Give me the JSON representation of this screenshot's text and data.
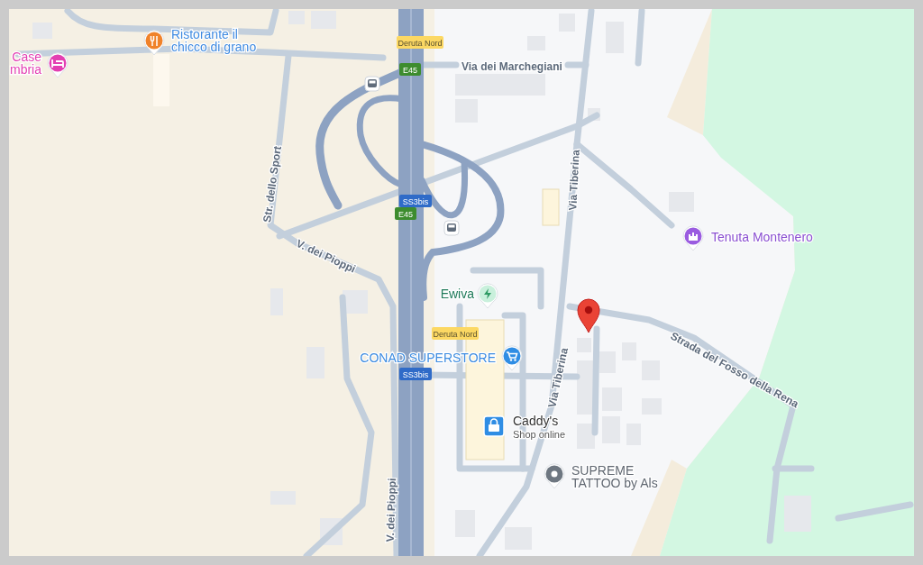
{
  "map": {
    "places": [
      {
        "kind": "hotel",
        "label": [
          "Case",
          "mbria"
        ]
      },
      {
        "kind": "restaurant",
        "label": [
          "Ristorante il",
          "chicco di grano"
        ]
      },
      {
        "kind": "transit"
      },
      {
        "kind": "transit"
      },
      {
        "kind": "ev_charger",
        "label": [
          "Ewiva"
        ]
      },
      {
        "kind": "supermarket",
        "label": [
          "CONAD SUPERSTORE"
        ]
      },
      {
        "kind": "shop",
        "label": [
          "Caddy's",
          "Shop online"
        ]
      },
      {
        "kind": "place",
        "label": [
          "SUPREME",
          "TATTOO by Als"
        ]
      },
      {
        "kind": "winery",
        "label": [
          "Tenuta Montenero"
        ]
      }
    ],
    "road_labels": [
      "Via dei Marchegiani",
      "Str. dello Sport",
      "V. dei Pioppi",
      "Via Tiberina",
      "Via Tiberina",
      "Strada del Fosso della Rena",
      "V. dei Pioppi"
    ],
    "shields": [
      {
        "kind": "exit",
        "text": "Deruta Nord"
      },
      {
        "kind": "euro_route",
        "text": "E45"
      },
      {
        "kind": "national",
        "text": "SS3bis"
      },
      {
        "kind": "euro_route",
        "text": "E45"
      },
      {
        "kind": "exit",
        "text": "Deruta Nord"
      },
      {
        "kind": "national",
        "text": "SS3bis"
      }
    ]
  }
}
